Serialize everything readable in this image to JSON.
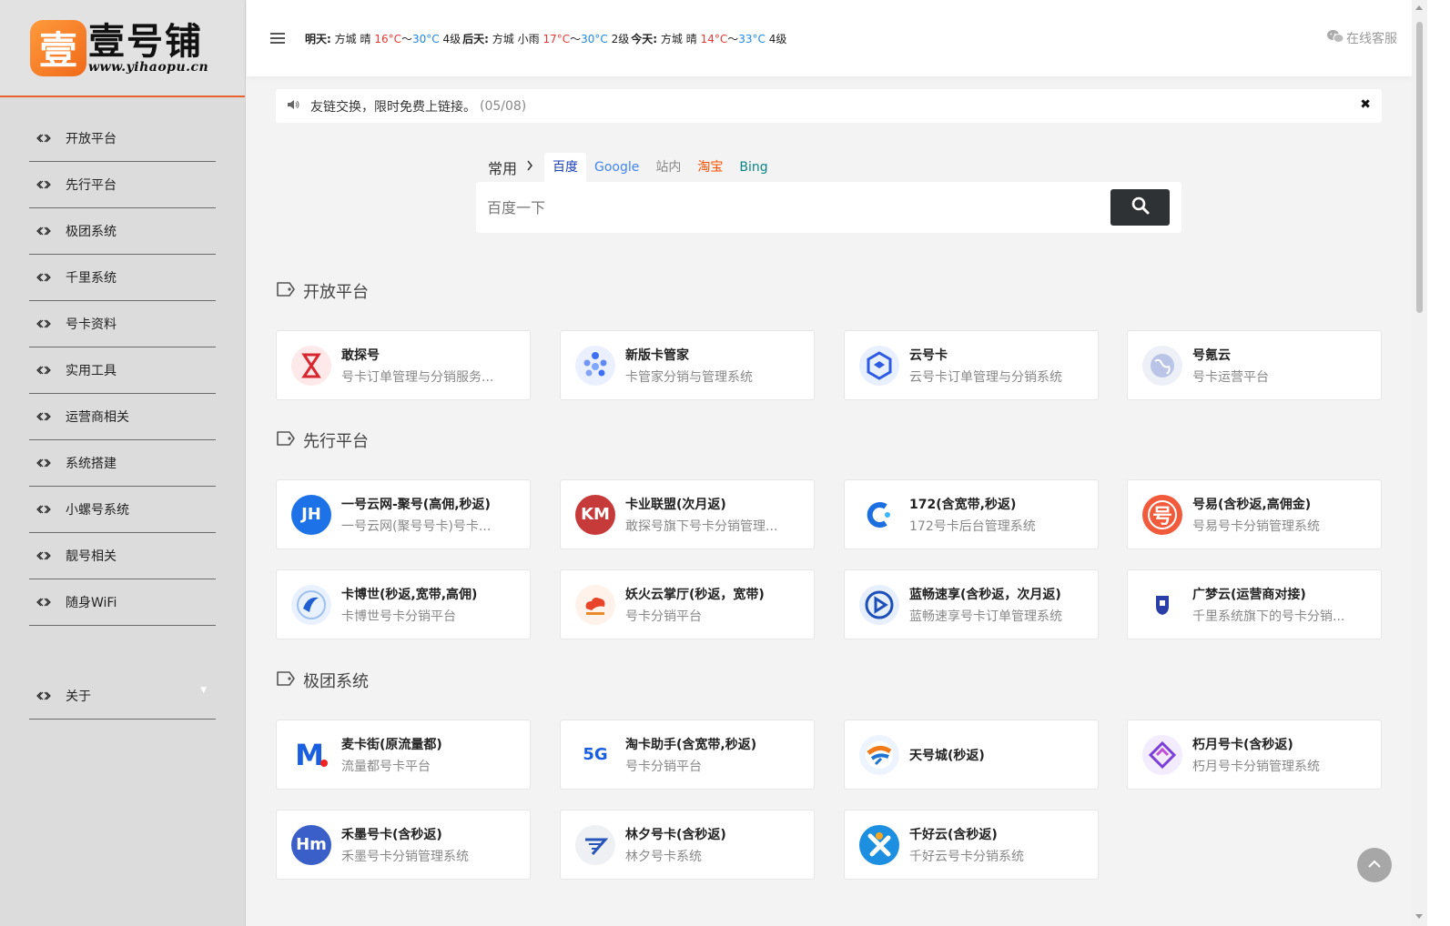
{
  "logo": {
    "badge_char": "壹",
    "title": "壹号铺",
    "subtitle": "www.yihaopu.cn"
  },
  "sidebar": {
    "items": [
      {
        "label": "开放平台"
      },
      {
        "label": "先行平台"
      },
      {
        "label": "极团系统"
      },
      {
        "label": "千里系统"
      },
      {
        "label": "号卡资料"
      },
      {
        "label": "实用工具"
      },
      {
        "label": "运营商相关"
      },
      {
        "label": "系统搭建"
      },
      {
        "label": "小螺号系统"
      },
      {
        "label": "靓号相关"
      },
      {
        "label": "随身WiFi"
      }
    ],
    "about": "关于"
  },
  "topbar": {
    "weather": [
      {
        "day": "明天:",
        "city": "方城",
        "cond": "晴",
        "low": "16°C",
        "sep": "～",
        "high": "30°C",
        "wind": "4级"
      },
      {
        "day": "后天:",
        "city": "方城",
        "cond": "小雨",
        "low": "17°C",
        "sep": "～",
        "high": "30°C",
        "wind": "2级"
      },
      {
        "day": "今天:",
        "city": "方城",
        "cond": "晴",
        "low": "14°C",
        "sep": "～",
        "high": "33°C",
        "wind": "4级"
      }
    ],
    "service": "在线客服"
  },
  "notice": {
    "text": "友链交换，限时免费上链接。",
    "date": "(05/08)"
  },
  "search": {
    "group": "常用",
    "tabs": [
      {
        "label": "百度",
        "color": "#1a3fb5"
      },
      {
        "label": "Google",
        "color": "#4285f4"
      },
      {
        "label": "站内",
        "color": "#888888"
      },
      {
        "label": "淘宝",
        "color": "#ff5000"
      },
      {
        "label": "Bing",
        "color": "#0c8484"
      }
    ],
    "placeholder": "百度一下"
  },
  "sections": [
    {
      "title": "开放平台",
      "cards": [
        {
          "name": "敢探号",
          "desc": "号卡订单管理与分销服务...",
          "icon": "hourglass-icon",
          "bg": "#fde8ea",
          "fg": "#d8282f"
        },
        {
          "name": "新版卡管家",
          "desc": "卡管家分销与管理系统",
          "icon": "dots-icon",
          "bg": "#eaf0ff",
          "fg": "#3d6ff0"
        },
        {
          "name": "云号卡",
          "desc": "云号卡订单管理与分销系统",
          "icon": "hexagon-icon",
          "bg": "#e8efff",
          "fg": "#2d5be3"
        },
        {
          "name": "号氪云",
          "desc": "号卡运营平台",
          "icon": "globe-icon",
          "bg": "#eef0f7",
          "fg": "#6b78a8"
        }
      ]
    },
    {
      "title": "先行平台",
      "cards": [
        {
          "name": "一号云网-聚号(高佣,秒返)",
          "desc": "一号云网(聚号号卡)号卡...",
          "icon": "jh-icon",
          "bg": "#1e72e8",
          "fg": "#ffffff",
          "glyph": "JH"
        },
        {
          "name": "卡业联盟(次月返)",
          "desc": "敢探号旗下号卡分销管理...",
          "icon": "km-icon",
          "bg": "#c73a3a",
          "fg": "#ffffff",
          "glyph": "KM"
        },
        {
          "name": "172(含宽带,秒返)",
          "desc": "172号卡后台管理系统",
          "icon": "c-logo-icon",
          "bg": "#ffffff",
          "fg": "#1b6fe0"
        },
        {
          "name": "号易(含秒返,高佣金)",
          "desc": "号易号卡分销管理系统",
          "icon": "hao-icon",
          "bg": "#f15a3a",
          "fg": "#ffffff",
          "glyph": "号"
        },
        {
          "name": "卡博世(秒返,宽带,高佣)",
          "desc": "卡博世号卡分销平台",
          "icon": "swirl-icon",
          "bg": "#e9f1ff",
          "fg": "#1f5fd1"
        },
        {
          "name": "妖火云掌厅(秒返，宽带)",
          "desc": "号卡分销平台",
          "icon": "cloud-fire-icon",
          "bg": "#fff2ea",
          "fg": "#e8442a"
        },
        {
          "name": "蓝畅速享(含秒返，次月返)",
          "desc": "蓝畅速享号卡订单管理系统",
          "icon": "play-icon",
          "bg": "#e7eefc",
          "fg": "#1d4fb8"
        },
        {
          "name": "广梦云(运营商对接)",
          "desc": "千里系统旗下的号卡分销...",
          "icon": "shield-icon",
          "bg": "#ffffff",
          "fg": "#2a3ea8"
        }
      ]
    },
    {
      "title": "极团系统",
      "cards": [
        {
          "name": "麦卡街(原流量都)",
          "desc": "流量都号卡平台",
          "icon": "m-logo-icon",
          "bg": "#ffffff",
          "fg": "#1a5fe0",
          "glyph": "M"
        },
        {
          "name": "淘卡助手(含宽带,秒返)",
          "desc": "号卡分销平台",
          "icon": "5g-icon",
          "bg": "#ffffff",
          "fg": "#1a5fe0",
          "glyph": "5G"
        },
        {
          "name": "天号城(秒返)",
          "desc": "",
          "icon": "runner-icon",
          "bg": "#eef4ff",
          "fg": "#f07a1a"
        },
        {
          "name": "朽月号卡(含秒返)",
          "desc": "朽月号卡分销管理系统",
          "icon": "diamond-icon",
          "bg": "#f3ecff",
          "fg": "#7b3fd9"
        },
        {
          "name": "禾墨号卡(含秒返)",
          "desc": "禾墨号卡分销管理系统",
          "icon": "hm-icon",
          "bg": "#3a5fc8",
          "fg": "#ffffff",
          "glyph": "Hm"
        },
        {
          "name": "林夕号卡(含秒返)",
          "desc": "林夕号卡系统",
          "icon": "wing-icon",
          "bg": "#eef0f3",
          "fg": "#2756b8"
        },
        {
          "name": "千好云(含秒返)",
          "desc": "千好云号卡分销系统",
          "icon": "x-logo-icon",
          "bg": "#1d8fe0",
          "fg": "#ffffff"
        }
      ]
    }
  ]
}
